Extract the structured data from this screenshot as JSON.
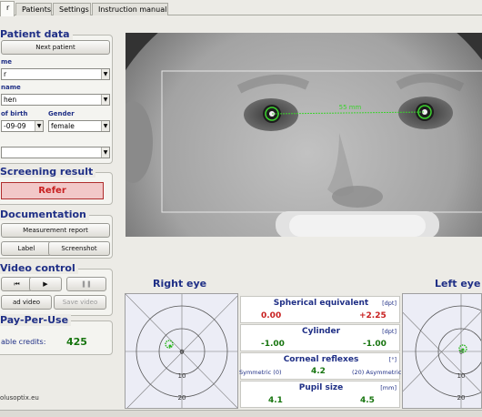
{
  "tabs": [
    {
      "label": "r"
    },
    {
      "label": "Patients"
    },
    {
      "label": "Settings"
    },
    {
      "label": "Instruction manual"
    }
  ],
  "patient_data": {
    "title": "Patient data",
    "next_patient": "Next patient",
    "name_label": "me",
    "name_value": "r",
    "firstname_label": "name",
    "firstname_value": "hen",
    "dob_label": "of birth",
    "dob_value": "-09-09",
    "gender_label": "Gender",
    "gender_value": "female",
    "extra_value": ""
  },
  "screening": {
    "title": "Screening result",
    "result": "Refer"
  },
  "documentation": {
    "title": "Documentation",
    "measurement_report": "Measurement report",
    "label": "Label",
    "screenshot": "Screenshot"
  },
  "video": {
    "title": "Video control",
    "prev_icon": "skip-back-icon",
    "play_icon": "play-icon",
    "pause_icon": "pause-icon",
    "load_video": "ad video",
    "save_video": "Save video"
  },
  "ppu": {
    "title": "Pay-Per-Use",
    "credits_label": "able credits:",
    "credits_value": "425"
  },
  "website": "olusoptix.eu",
  "camera": {
    "distance_label": "55 mm"
  },
  "right_eye": {
    "title": "Right eye",
    "ring_label_inner": "10",
    "ring_label_outer": "20",
    "center_label": "0"
  },
  "left_eye": {
    "title": "Left eye",
    "ring_label_inner": "10",
    "ring_label_outer": "20",
    "center_label": "0"
  },
  "results": {
    "spherical": {
      "title": "Spherical equivalent",
      "unit": "[dpt]",
      "right": "0.00",
      "left": "+2.25"
    },
    "cylinder": {
      "title": "Cylinder",
      "unit": "[dpt]",
      "right": "-1.00",
      "left": "-1.00"
    },
    "corneal": {
      "title": "Corneal reflexes",
      "unit": "[°]",
      "left_caption": "Symmetric (0)",
      "value": "4.2",
      "right_caption": "(20) Asymmetric"
    },
    "pupil": {
      "title": "Pupil size",
      "unit": "[mm]",
      "right": "4.1",
      "left": "4.5"
    }
  },
  "colors": {
    "accent": "#1f2f86",
    "refer_red": "#c82020",
    "value_green": "#17750f",
    "value_red": "#c81e1e"
  }
}
